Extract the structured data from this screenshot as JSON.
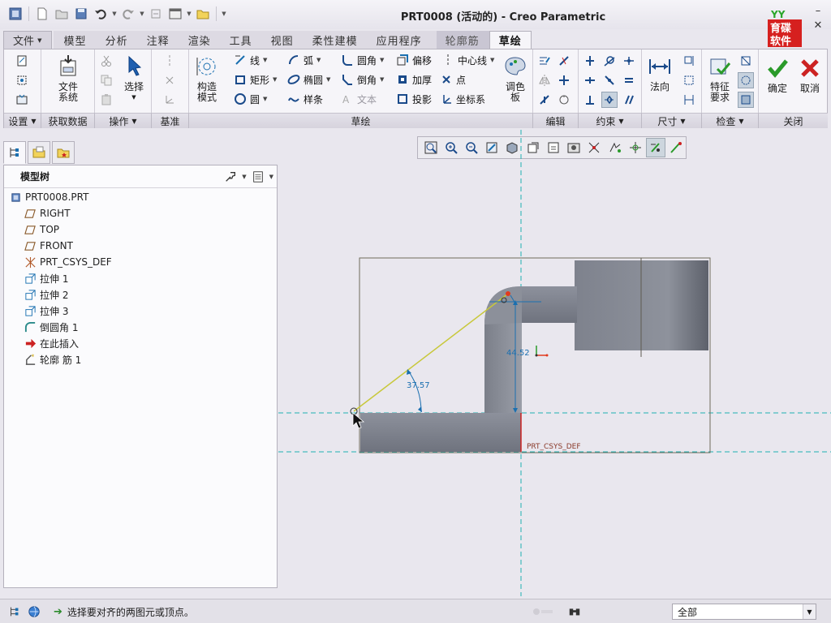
{
  "window": {
    "title": "PRT0008 (活动的) - Creo Parametric"
  },
  "logo_text": "育碟软件",
  "tabs": [
    {
      "label": "文件"
    },
    {
      "label": "模型"
    },
    {
      "label": "分析"
    },
    {
      "label": "注释"
    },
    {
      "label": "渲染"
    },
    {
      "label": "工具"
    },
    {
      "label": "视图"
    },
    {
      "label": "柔性建模"
    },
    {
      "label": "应用程序"
    },
    {
      "label": "轮廓筋"
    },
    {
      "label": "草绘"
    }
  ],
  "ribbon": {
    "file_system": "文件\n系统",
    "file_system_a": "文件",
    "file_system_b": "系统",
    "select": "选择",
    "construct_a": "构造",
    "construct_b": "模式",
    "line": "线",
    "rect": "矩形",
    "circle": "圆",
    "arc": "弧",
    "ellipse": "椭圆",
    "spline": "样条",
    "fillet": "圆角",
    "chamfer": "倒角",
    "text": "文本",
    "offset": "偏移",
    "thicken": "加厚",
    "project": "投影",
    "centerline": "中心线",
    "point": "点",
    "csys": "坐标系",
    "palette_a": "调色",
    "palette_b": "板",
    "normal": "法向",
    "feature_a": "特征",
    "feature_b": "要求",
    "ok": "确定",
    "cancel": "取消",
    "groups": {
      "setup": "设置",
      "getdata": "获取数据",
      "ops": "操作",
      "datum": "基准",
      "sketch": "草绘",
      "edit": "编辑",
      "constrain": "约束",
      "dimension": "尺寸",
      "inspect": "检查",
      "close": "关闭"
    }
  },
  "model_tree": {
    "title": "模型树",
    "items": [
      {
        "label": "PRT0008.PRT",
        "icon": "part-icon"
      },
      {
        "label": "RIGHT",
        "icon": "datum-plane-icon"
      },
      {
        "label": "TOP",
        "icon": "datum-plane-icon"
      },
      {
        "label": "FRONT",
        "icon": "datum-plane-icon"
      },
      {
        "label": "PRT_CSYS_DEF",
        "icon": "csys-icon"
      },
      {
        "label": "拉伸 1",
        "icon": "extrude-icon"
      },
      {
        "label": "拉伸 2",
        "icon": "extrude-icon"
      },
      {
        "label": "拉伸 3",
        "icon": "extrude-icon"
      },
      {
        "label": "倒圆角 1",
        "icon": "round-icon"
      },
      {
        "label": "在此插入",
        "icon": "insert-arrow-icon"
      },
      {
        "label": "轮廓 筋 1",
        "icon": "profile-rib-icon"
      }
    ]
  },
  "canvas": {
    "angle_dim": "37.57",
    "vertical_dim": "44.52",
    "csys_label": "PRT_CSYS_DEF"
  },
  "status": {
    "message": "选择要对齐的两图元或顶点。",
    "filter_value": "全部"
  },
  "colors": {
    "accent_green": "#2a9a2a",
    "cancel_red": "#cc2222",
    "datum_cyan": "#1fb2b2",
    "dim_blue": "#1a6fb0",
    "sketch_yellow": "#c8c83a",
    "part_gray": "#8a8e99"
  }
}
